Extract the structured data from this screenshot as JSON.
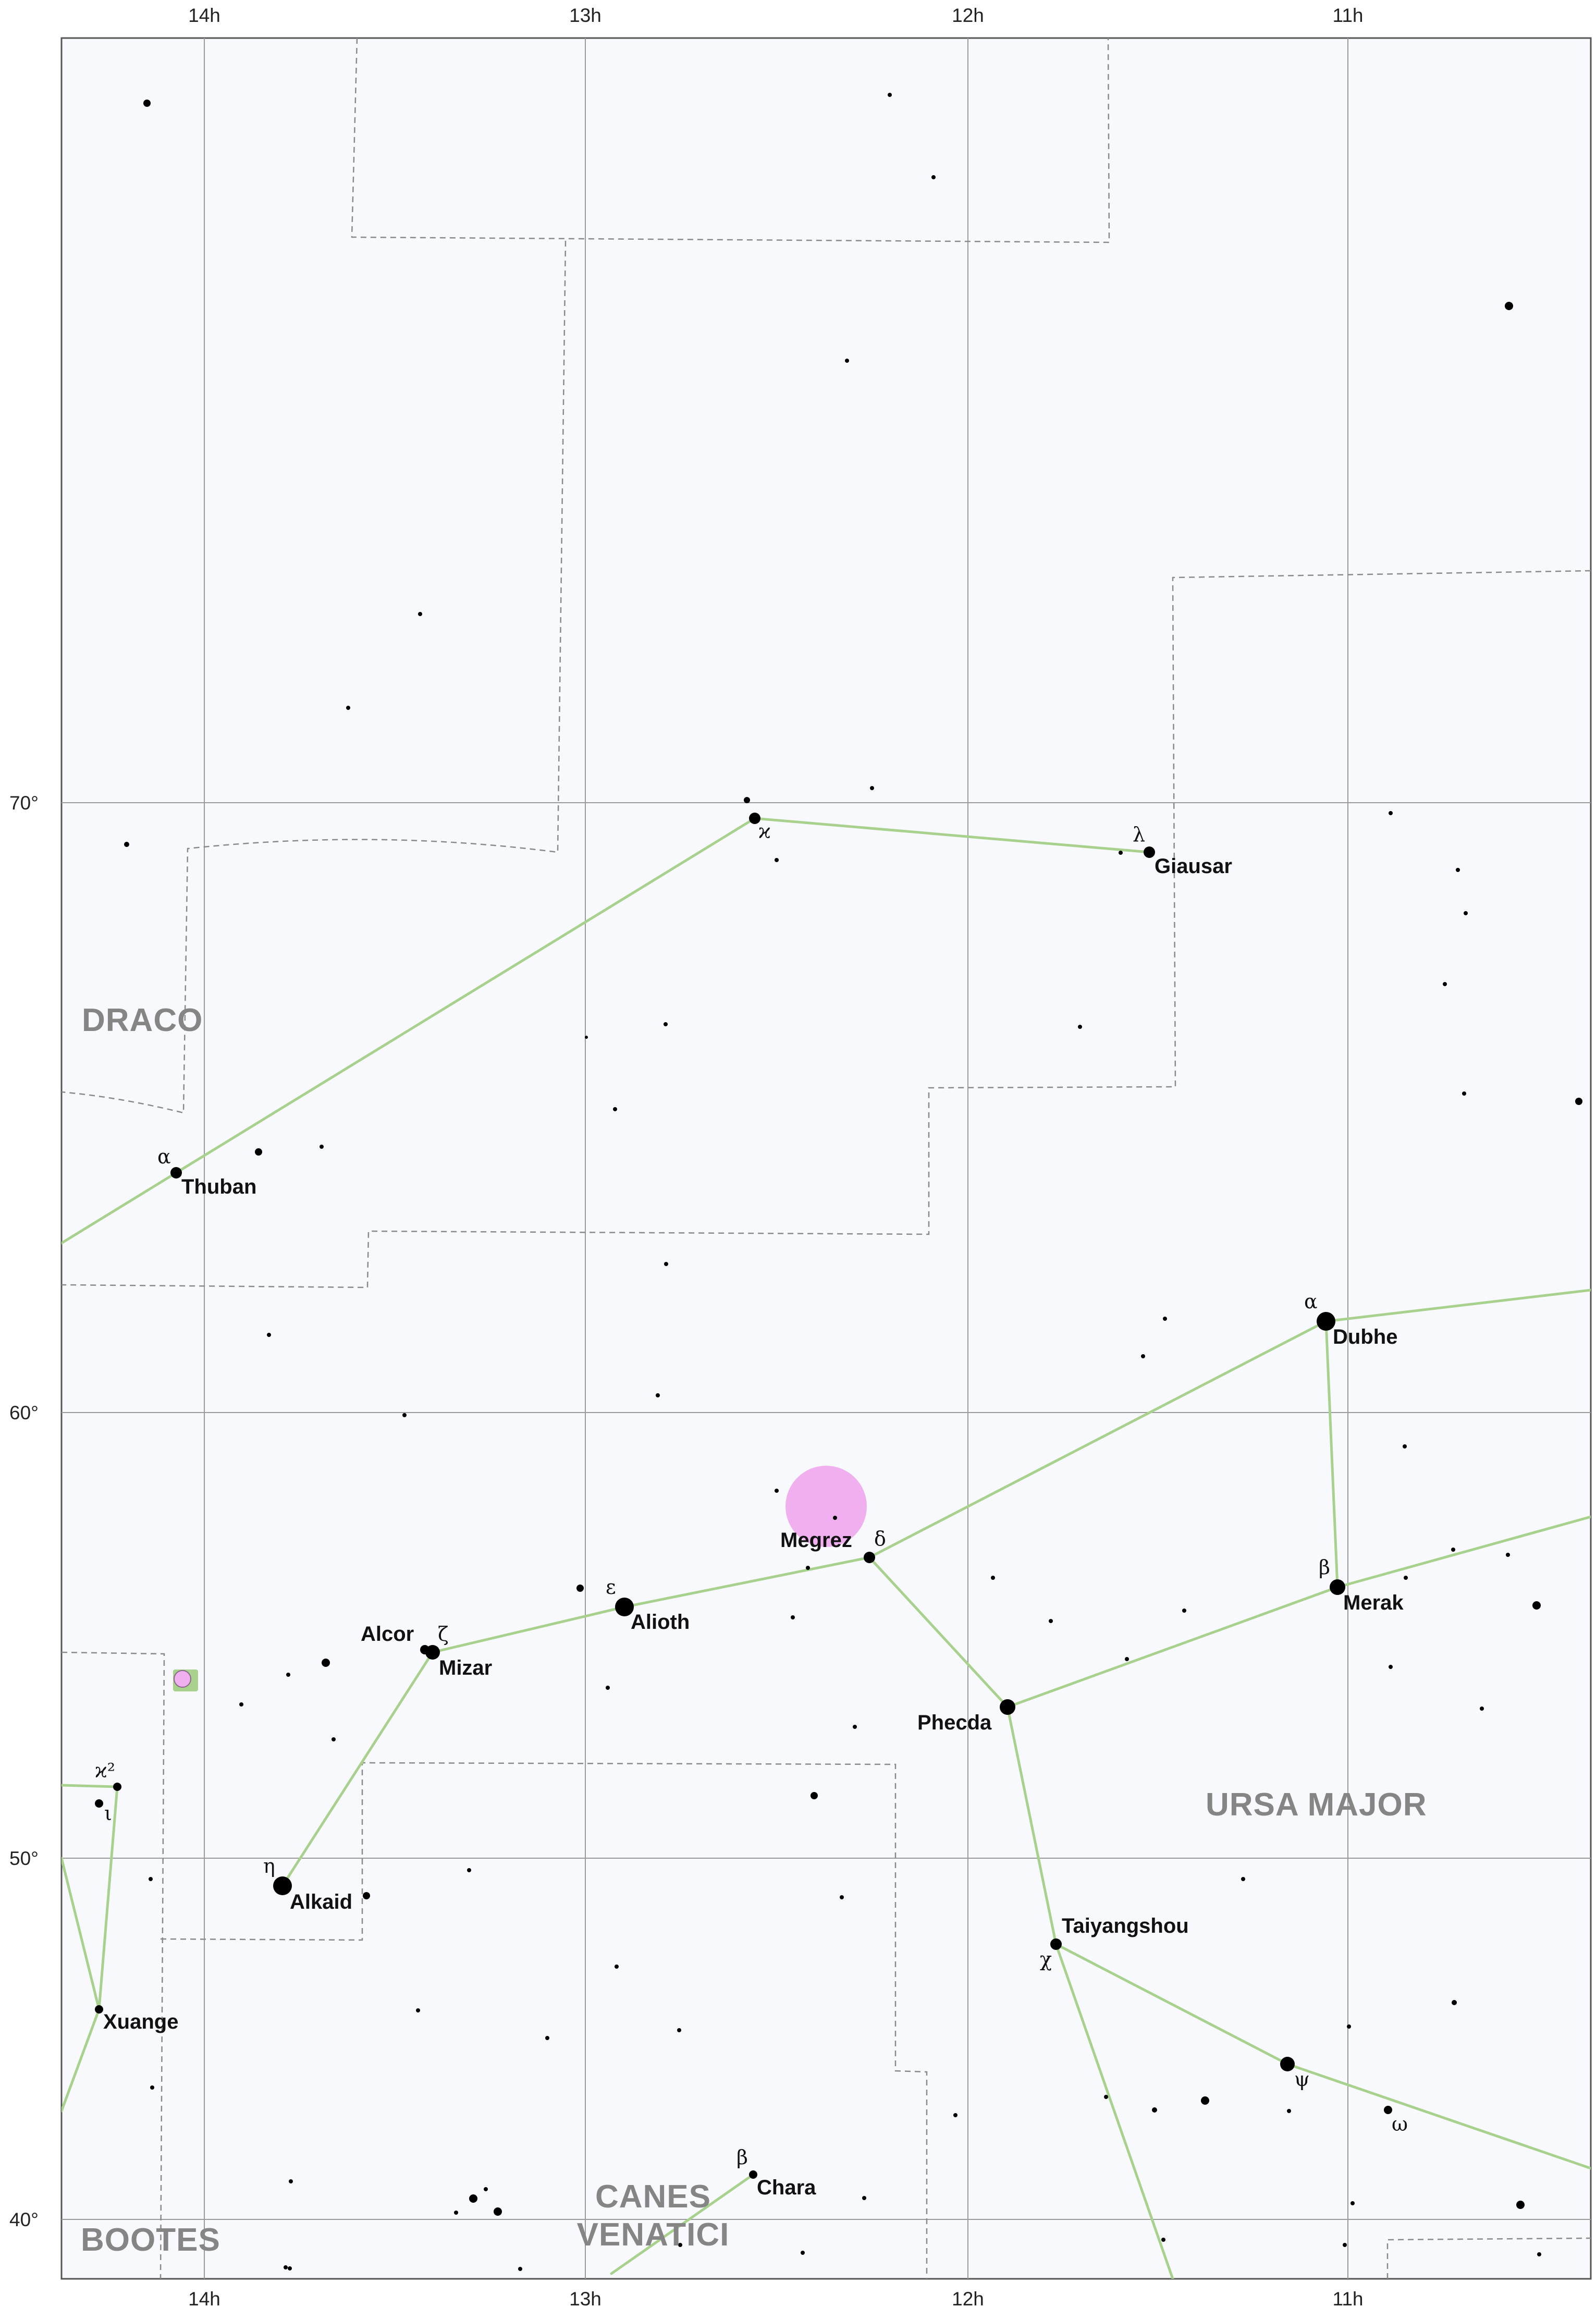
{
  "axes": {
    "ra_labels": [
      "14h",
      "13h",
      "12h",
      "11h"
    ],
    "dec_labels": [
      "70°",
      "60°",
      "50°",
      "40°"
    ]
  },
  "constellations": [
    "DRACO",
    "URSA MAJOR",
    "CANES",
    "VENATICI",
    "BOOTES"
  ],
  "stars": {
    "thuban": {
      "name": "Thuban",
      "greek": "α"
    },
    "kappa_dra": {
      "greek": "ϰ"
    },
    "giausar": {
      "name": "Giausar",
      "greek": "λ"
    },
    "dubhe": {
      "name": "Dubhe",
      "greek": "α"
    },
    "merak": {
      "name": "Merak",
      "greek": "β"
    },
    "phecda": {
      "name": "Phecda"
    },
    "megrez": {
      "name": "Megrez",
      "greek": "δ"
    },
    "alioth": {
      "name": "Alioth",
      "greek": "ε"
    },
    "mizar": {
      "name": "Mizar",
      "greek": "ζ"
    },
    "alcor": {
      "name": "Alcor"
    },
    "alkaid": {
      "name": "Alkaid",
      "greek": "η"
    },
    "taiyangshou": {
      "name": "Taiyangshou",
      "greek": "χ"
    },
    "psi_uma": {
      "greek": "ψ"
    },
    "omega_uma": {
      "greek": "ω"
    },
    "chara": {
      "name": "Chara",
      "greek": "β"
    },
    "xuange": {
      "name": "Xuange"
    },
    "kappa2_boo": {
      "greek": "ϰ²"
    },
    "iota_boo": {
      "greek": "ι"
    }
  },
  "colors": {
    "background": "#f8f9fc",
    "grid": "#9a9a9a",
    "boundary": "#8a8a8a",
    "constellation_line": "#a9d18e",
    "star": "#000000",
    "galaxy": "#f0b0ef",
    "cluster_box": "#a9d18e"
  }
}
